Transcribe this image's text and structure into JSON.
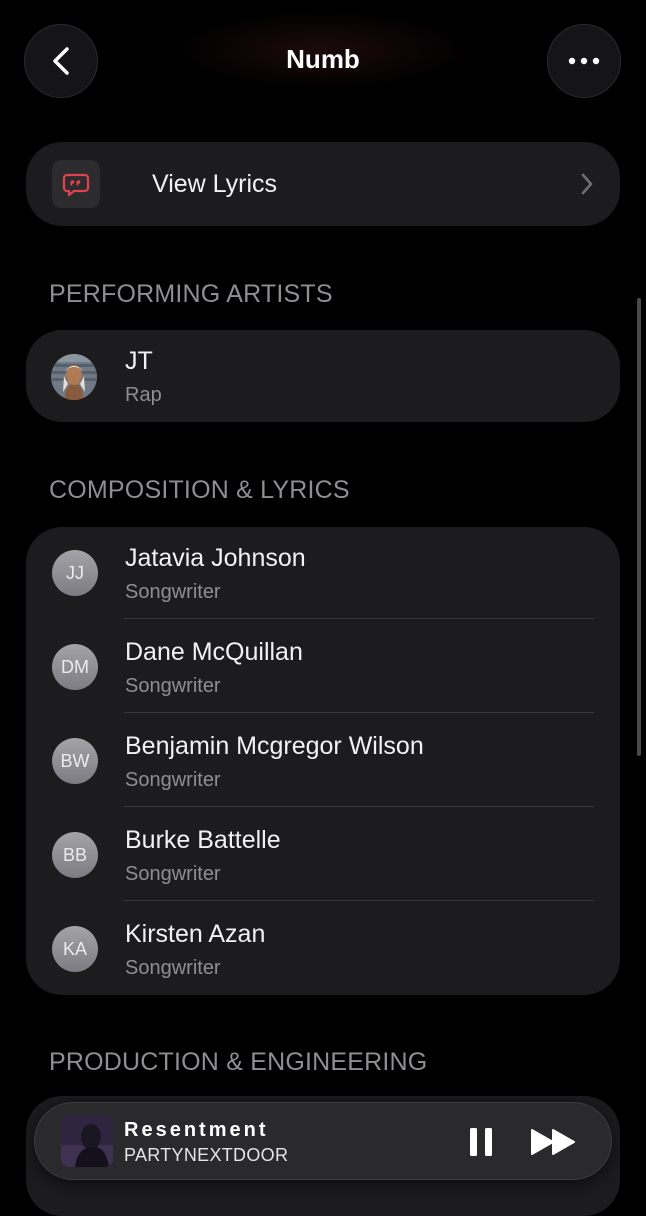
{
  "header": {
    "title": "Numb"
  },
  "lyrics": {
    "label": "View Lyrics"
  },
  "sections": {
    "performing": "PERFORMING ARTISTS",
    "composition": "COMPOSITION & LYRICS",
    "production": "PRODUCTION & ENGINEERING"
  },
  "artist": {
    "name": "JT",
    "role": "Rap"
  },
  "composition": [
    {
      "initials": "JJ",
      "name": "Jatavia Johnson",
      "role": "Songwriter"
    },
    {
      "initials": "DM",
      "name": "Dane McQuillan",
      "role": "Songwriter"
    },
    {
      "initials": "BW",
      "name": "Benjamin Mcgregor Wilson",
      "role": "Songwriter"
    },
    {
      "initials": "BB",
      "name": "Burke Battelle",
      "role": "Songwriter"
    },
    {
      "initials": "KA",
      "name": "Kirsten Azan",
      "role": "Songwriter"
    }
  ],
  "player": {
    "title": "Resentment",
    "artist": "PARTYNEXTDOOR"
  },
  "colors": {
    "accent": "#e0424f",
    "background": "#000000",
    "card": "#1c1c1e",
    "secondary_text": "#8e8e93"
  }
}
